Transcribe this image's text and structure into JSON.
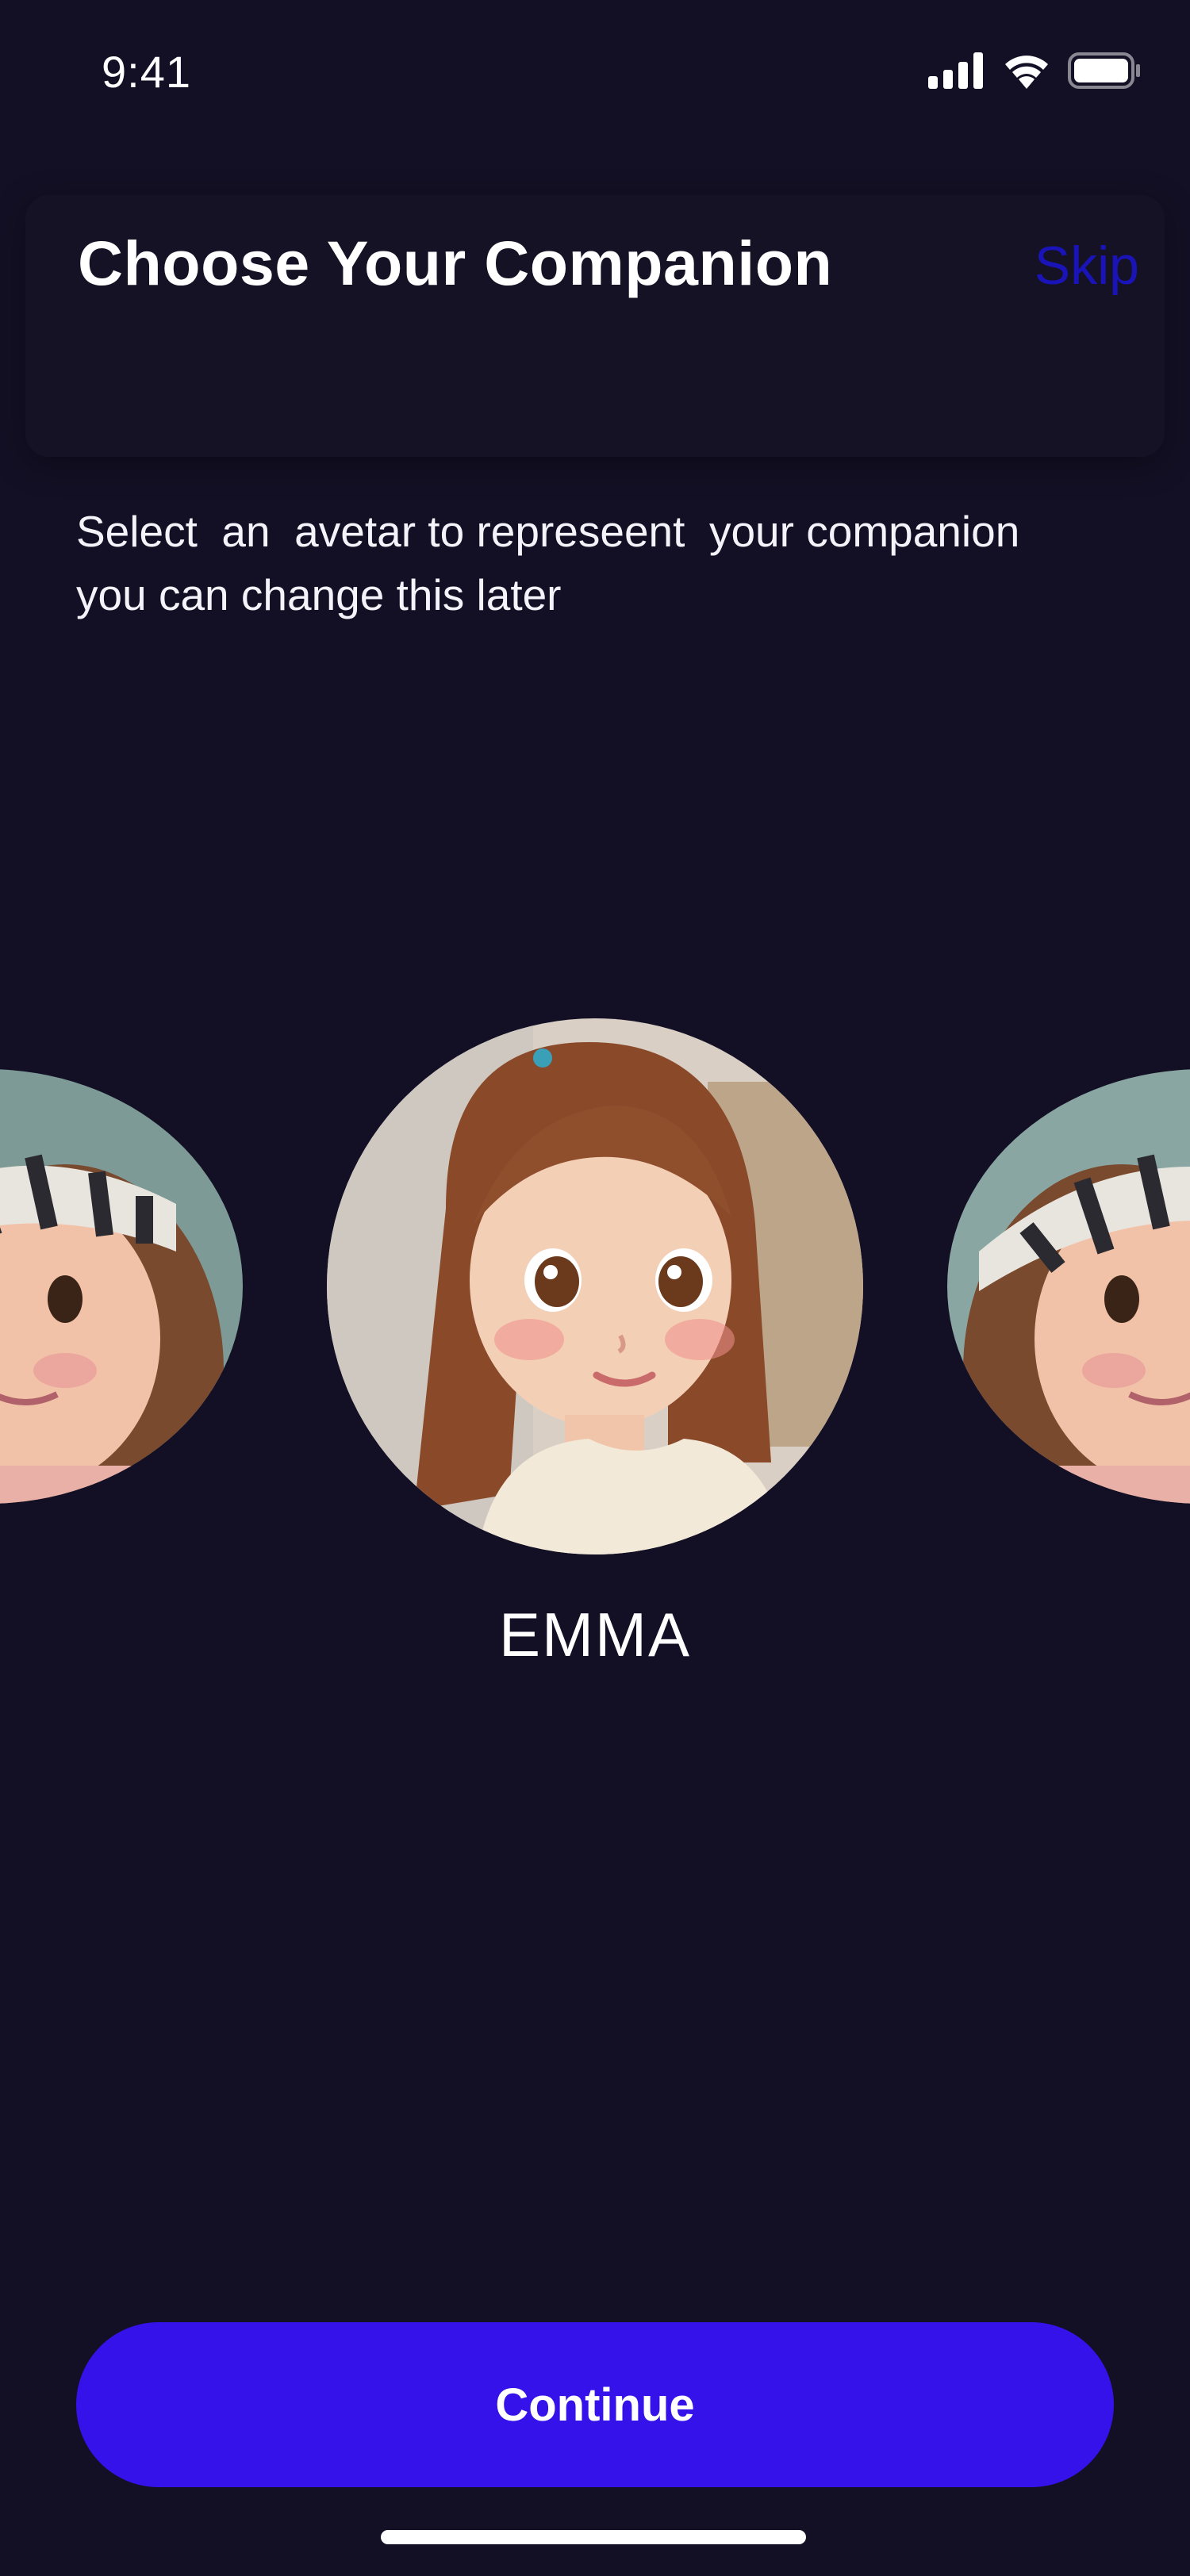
{
  "status_bar": {
    "time": "9:41",
    "icons": [
      "signal-icon",
      "wifi-icon",
      "battery-icon"
    ]
  },
  "header": {
    "title": "Choose Your Companion",
    "skip_label": "Skip"
  },
  "subtitle": {
    "line1": "Select  an  avetar to represeent  your companion",
    "line2": "you can change this later"
  },
  "carousel": {
    "selected_name": "EMMA",
    "avatars": [
      {
        "position": "left",
        "description": "girl-with-zebra-cap"
      },
      {
        "position": "center",
        "description": "girl-with-ponytail"
      },
      {
        "position": "right",
        "description": "girl-with-zebra-cap"
      }
    ]
  },
  "actions": {
    "continue_label": "Continue"
  },
  "colors": {
    "background": "#131025",
    "header_card": "#141224",
    "accent": "#3512ea",
    "skip": "#1a14b8",
    "text": "#ffffff"
  }
}
